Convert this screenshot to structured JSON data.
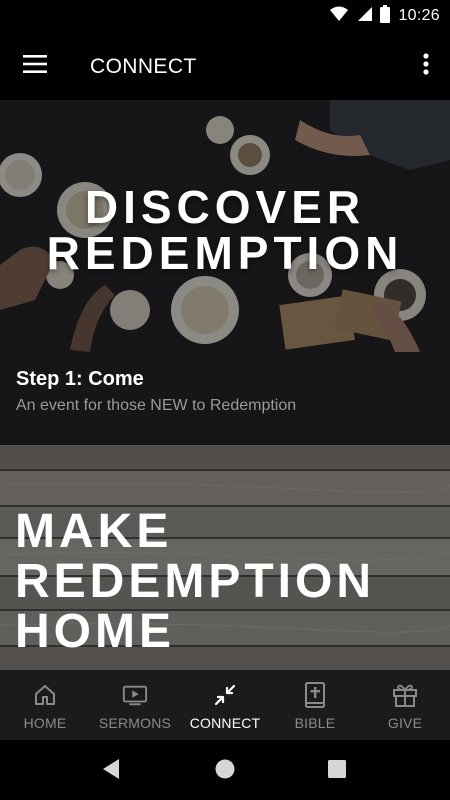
{
  "status_bar": {
    "time": "10:26"
  },
  "app_bar": {
    "title": "CONNECT"
  },
  "feed": {
    "card1": {
      "hero_line1": "DISCOVER",
      "hero_line2": "REDEMPTION",
      "title": "Step 1: Come",
      "subtitle": "An event for those NEW to Redemption"
    },
    "card2": {
      "hero_line1": "MAKE",
      "hero_line2": "REDEMPTION",
      "hero_line3": "HOME"
    }
  },
  "bottom_nav": {
    "items": [
      {
        "label": "HOME",
        "icon": "home-icon"
      },
      {
        "label": "SERMONS",
        "icon": "video-icon"
      },
      {
        "label": "CONNECT",
        "icon": "connect-arrows-icon",
        "active": true
      },
      {
        "label": "BIBLE",
        "icon": "bible-icon"
      },
      {
        "label": "GIVE",
        "icon": "gift-icon"
      }
    ]
  },
  "colors": {
    "background": "#000000",
    "card": "#161616",
    "nav_bg": "#1b1b1b",
    "nav_inactive": "#8a8a8a",
    "nav_active": "#ffffff"
  }
}
